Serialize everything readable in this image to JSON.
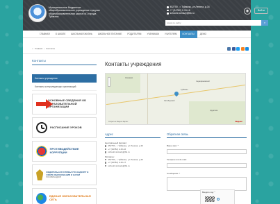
{
  "header": {
    "school_name": "Муниципальное бюджетное общеобразовательное учреждение средняя общеобразовательная школа №1 города Туймазы",
    "address": "452750 , г. Туймазы, ул.Ленина, д.34",
    "phone": "+7 (34782) 2-15-16",
    "email": "school1.tuimazy@bk.ru",
    "login_label": "Войти",
    "search_placeholder": "поиск по сайту"
  },
  "nav": {
    "items": [
      "ГЛАВНАЯ",
      "О ШКОЛЕ",
      "ШКОЛЬНАЯ ЖИЗНЬ",
      "ШКОЛЬНОЕ ПИТАНИЕ",
      "РОДИТЕЛЯМ",
      "УЧЕНИКАМ",
      "УЧИТЕЛЯМ",
      "КОНТАКТЫ",
      "ДЕМО"
    ],
    "active_index": 7
  },
  "breadcrumb": {
    "home": "Главная",
    "current": "Контакты"
  },
  "sidebar": {
    "title": "Контакты",
    "items": [
      "Контакты учреждения",
      "Контакты контролирующих организаций"
    ],
    "banners": [
      {
        "text": "ОСНОВНЫЕ СВЕДЕНИЯ ОБ ОБРАЗОВАТЕЛЬНОЙ ОРГАНИЗАЦИИ",
        "icon": "arrow-icon"
      },
      {
        "text": "РАСПИСАНИЕ УРОКОВ",
        "icon": "clock-icon"
      },
      {
        "text": "ПРОТИВОДЕЙСТВИЕ КОРРУПЦИИ",
        "icon": "anti-corruption-icon"
      },
      {
        "text": "ФЕДЕРАЛЬНАЯ СЛУЖБА ПО НАДЗОРУ В СФЕРЕ ОБРАЗОВАНИЯ И НАУКИ",
        "sub": "РОСОБРНАДЗОР",
        "icon": "eagle-icon"
      },
      {
        "text": "ЕДИНАЯ ОБРАЗОВАТЕЛЬНАЯ СЕТЬ",
        "icon": "globe-icon"
      }
    ]
  },
  "main": {
    "title": "Контакты учреждения",
    "map": {
      "towns": [
        "Уразаево",
        "Туймазы",
        "Октябрьский",
        "Серафимовский",
        "Ардатово"
      ],
      "footer": "Открыть в Яндекс.Картах",
      "brand": "Яндекс"
    },
    "address_title": "Адрес",
    "central_branch": "Центральный филиал:",
    "central_address": "452750 , г. Туймазы, ул.Ленина, д.34",
    "central_phone": "+7 (34782) 2-15-16",
    "central_email": "school1.tuimazy@bk.ru",
    "branches_head": "Филиалы:",
    "branch_address": "452750 , г. Туймазы, ул.Ленина, д.34",
    "branch_phone": "+7 (34782) 2-15-17",
    "branch_email": "school1.tuimazy@bk.ru",
    "feedback_title": "Обратная связь",
    "name_label": "Ваше имя: *",
    "contact_label": "Телефон или E-mail:",
    "message_label": "Сообщение: *",
    "captcha_label": "Введите код: *"
  },
  "colors": {
    "accent": "#3d8fc7",
    "header_bg": "#3b3f44",
    "page_bg": "#2aa3a0"
  }
}
